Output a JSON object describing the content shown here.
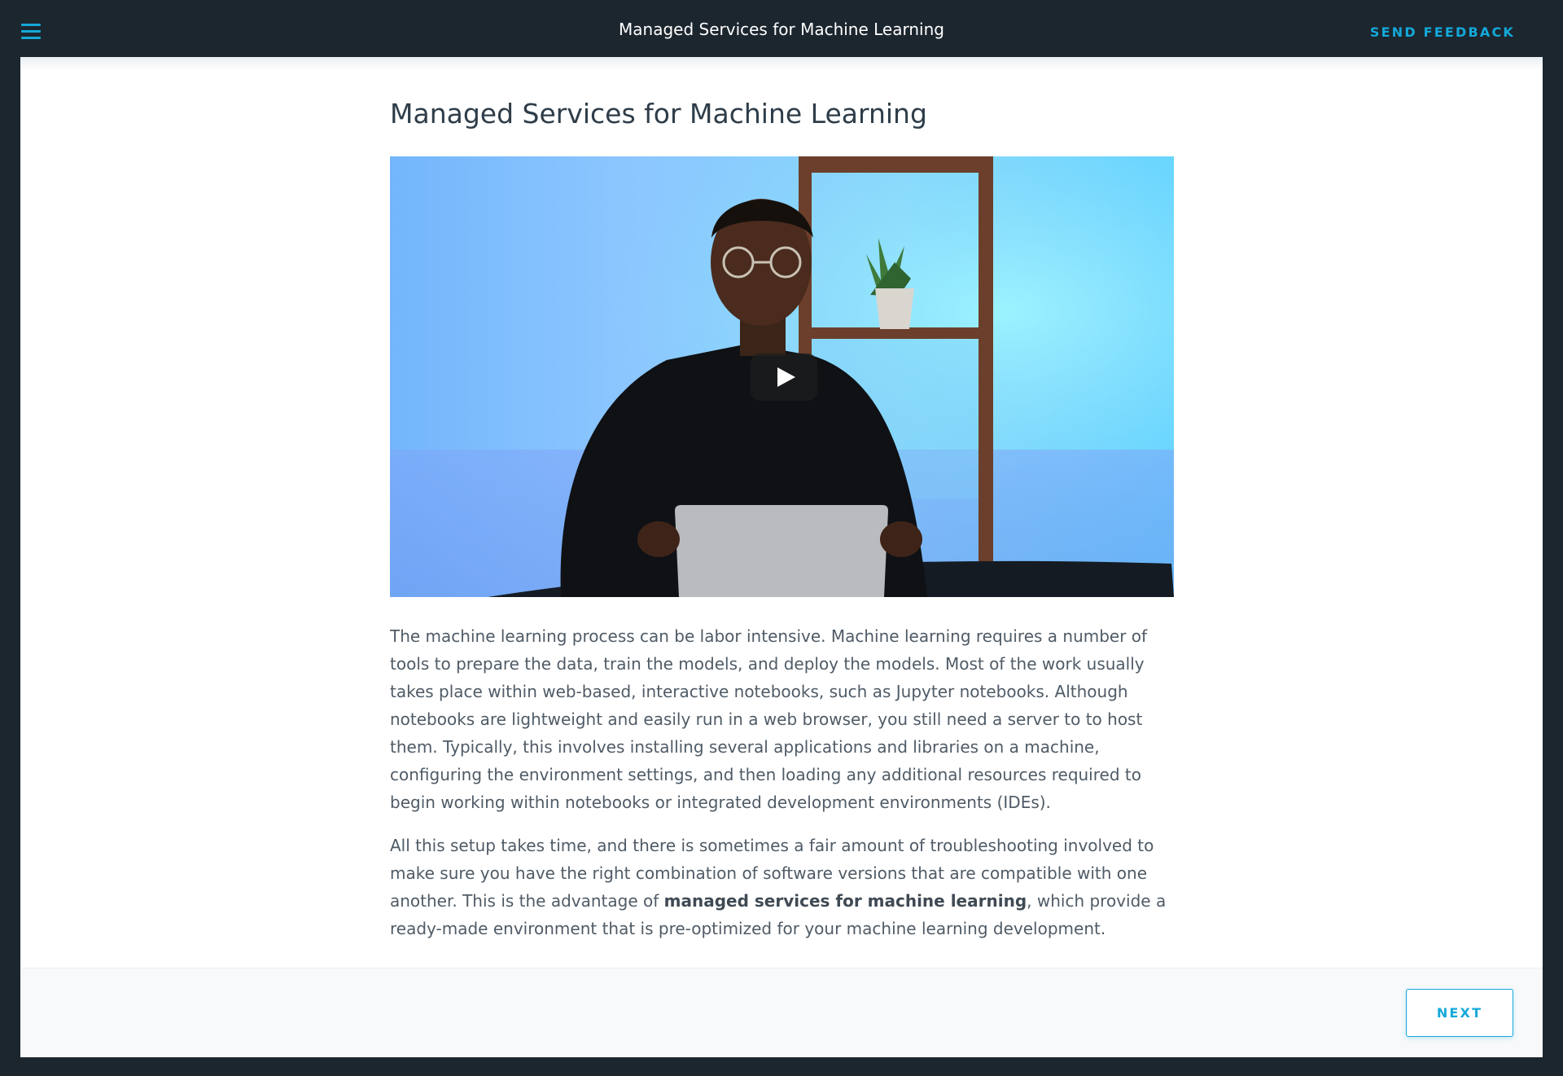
{
  "header": {
    "title": "Managed Services for Machine Learning",
    "menu_icon": "hamburger-menu-icon",
    "feedback_label": "SEND FEEDBACK",
    "accent_color": "#14a9d9"
  },
  "main": {
    "title": "Managed Services for Machine Learning",
    "video": {
      "play_icon": "play-icon"
    },
    "paragraphs": {
      "p1": "The machine learning process can be labor intensive. Machine learning requires a number of tools to prepare the data, train the models, and deploy the models. Most of the work usually takes place within web-based, interactive notebooks, such as Jupyter notebooks. Although notebooks are lightweight and easily run in a web browser, you still need a server to to host them. Typically, this involves installing several applications and libraries on a machine, configuring the environment settings, and then loading any additional resources required to begin working within notebooks or integrated development environments (IDEs).",
      "p2_before": "All this setup takes time, and there is sometimes a fair amount of troubleshooting involved to make sure you have the right combination of software versions that are compatible with one another. This is the advantage of ",
      "p2_bold": "managed services for machine learning",
      "p2_after": ", which provide a ready-made environment that is pre-optimized for your machine learning development."
    }
  },
  "footer": {
    "next_label": "NEXT"
  }
}
